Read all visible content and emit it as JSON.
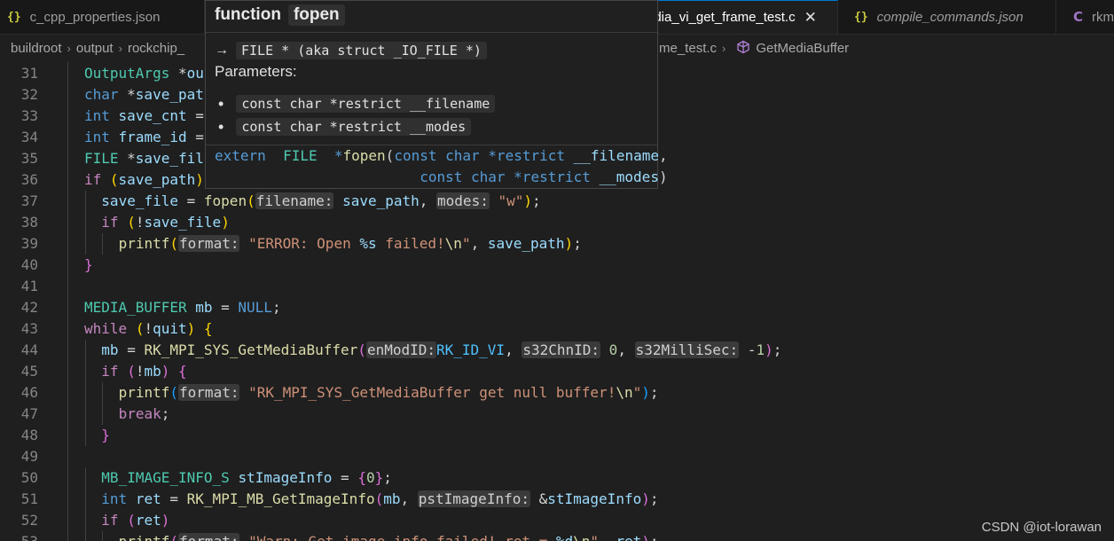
{
  "tabs": [
    {
      "icon": "{}",
      "label": "c_cpp_properties.json",
      "active": false
    },
    {
      "icon": "",
      "label": "edia_vi_get_frame_test.c",
      "active": true,
      "close": "✕"
    },
    {
      "icon": "{}",
      "label": "compile_commands.json",
      "active": false
    },
    {
      "icon": "C",
      "label": "rkm",
      "active": false
    }
  ],
  "breadcrumb": {
    "items": [
      "buildroot",
      "output",
      "rockchip_"
    ],
    "right_file": "me_test.c",
    "symbol": "GetMediaBuffer",
    "sep": "›"
  },
  "hover": {
    "kind": "function",
    "name": "fopen",
    "arrow": "→",
    "return_type": "FILE * (aka struct _IO_FILE *)",
    "params_label": "Parameters:",
    "bullet": "•",
    "params": [
      "const char *restrict __filename",
      "const char *restrict __modes"
    ],
    "signature": [
      [
        [
          "tk-kw",
          "extern"
        ],
        [
          "",
          "  "
        ],
        [
          "tk-type",
          "FILE"
        ],
        [
          "",
          "  "
        ],
        [
          "tk-kw",
          "*"
        ],
        [
          "tk-fn",
          "fopen"
        ],
        [
          "tk-op",
          "("
        ],
        [
          "tk-kw",
          "const"
        ],
        [
          "",
          " "
        ],
        [
          "tk-kw",
          "char"
        ],
        [
          "",
          " "
        ],
        [
          "tk-kw",
          "*restrict"
        ],
        [
          "",
          " "
        ],
        [
          "tk-var",
          "__filename"
        ],
        [
          "tk-op",
          ","
        ]
      ],
      [
        [
          "",
          "                        "
        ],
        [
          "tk-kw",
          "const"
        ],
        [
          "",
          " "
        ],
        [
          "tk-kw",
          "char"
        ],
        [
          "",
          " "
        ],
        [
          "tk-kw",
          "*restrict"
        ],
        [
          "",
          " "
        ],
        [
          "tk-var",
          "__modes"
        ],
        [
          "tk-op",
          ")"
        ]
      ]
    ]
  },
  "editor": {
    "lines": [
      {
        "n": "31",
        "i": 0,
        "t": [
          [
            "tk-type",
            "OutputArgs"
          ],
          [
            "tk-op",
            " *"
          ],
          [
            "tk-var",
            "ou"
          ]
        ]
      },
      {
        "n": "32",
        "i": 0,
        "t": [
          [
            "tk-kw",
            "char"
          ],
          [
            "tk-op",
            " *"
          ],
          [
            "tk-var",
            "save_pat"
          ]
        ]
      },
      {
        "n": "33",
        "i": 0,
        "t": [
          [
            "tk-kw",
            "int"
          ],
          [
            "tk-op",
            " "
          ],
          [
            "tk-var",
            "save_cnt"
          ],
          [
            "tk-op",
            " ="
          ]
        ]
      },
      {
        "n": "34",
        "i": 0,
        "t": [
          [
            "tk-kw",
            "int"
          ],
          [
            "tk-op",
            " "
          ],
          [
            "tk-var",
            "frame_id"
          ],
          [
            "tk-op",
            " ="
          ]
        ]
      },
      {
        "n": "35",
        "i": 0,
        "t": [
          [
            "tk-type",
            "FILE"
          ],
          [
            "tk-op",
            " *"
          ],
          [
            "tk-var",
            "save_fil"
          ]
        ]
      },
      {
        "n": "36",
        "i": 0,
        "t": [
          [
            "tk-ctl",
            "if"
          ],
          [
            "tk-op",
            " "
          ],
          [
            "tk-b1",
            "("
          ],
          [
            "tk-var",
            "save_path"
          ],
          [
            "tk-b1",
            ")"
          ]
        ]
      },
      {
        "n": "37",
        "i": 1,
        "t": [
          [
            "tk-var",
            "save_file"
          ],
          [
            "tk-op",
            " = "
          ],
          [
            "tk-fn",
            "fopen"
          ],
          [
            "tk-b1",
            "("
          ],
          [
            "hint",
            "filename:"
          ],
          [
            "tk-op",
            " "
          ],
          [
            "tk-var",
            "save_path"
          ],
          [
            "tk-op",
            ", "
          ],
          [
            "hint",
            "modes:"
          ],
          [
            "tk-op",
            " "
          ],
          [
            "tk-str",
            "\"w\""
          ],
          [
            "tk-b1",
            ")"
          ],
          [
            "tk-op",
            ";"
          ]
        ]
      },
      {
        "n": "38",
        "i": 1,
        "t": [
          [
            "tk-ctl",
            "if"
          ],
          [
            "tk-op",
            " "
          ],
          [
            "tk-b1",
            "("
          ],
          [
            "tk-op",
            "!"
          ],
          [
            "tk-var",
            "save_file"
          ],
          [
            "tk-b1",
            ")"
          ]
        ]
      },
      {
        "n": "39",
        "i": 2,
        "t": [
          [
            "tk-fn",
            "printf"
          ],
          [
            "tk-b1",
            "("
          ],
          [
            "hint",
            "format:"
          ],
          [
            "tk-op",
            " "
          ],
          [
            "tk-str",
            "\"ERROR: Open "
          ],
          [
            "tk-var",
            "%s"
          ],
          [
            "tk-str",
            " failed!"
          ],
          [
            "tk-fn",
            "\\n"
          ],
          [
            "tk-str",
            "\""
          ],
          [
            "tk-op",
            ", "
          ],
          [
            "tk-var",
            "save_path"
          ],
          [
            "tk-b1",
            ")"
          ],
          [
            "tk-op",
            ";"
          ]
        ]
      },
      {
        "n": "40",
        "i": 0,
        "t": [
          [
            "tk-b2",
            "}"
          ]
        ]
      },
      {
        "n": "41",
        "i": 0,
        "t": []
      },
      {
        "n": "42",
        "i": 0,
        "t": [
          [
            "tk-type",
            "MEDIA_BUFFER"
          ],
          [
            "tk-op",
            " "
          ],
          [
            "tk-var",
            "mb"
          ],
          [
            "tk-op",
            " = "
          ],
          [
            "tk-kw",
            "NULL"
          ],
          [
            "tk-op",
            ";"
          ]
        ]
      },
      {
        "n": "43",
        "i": 0,
        "t": [
          [
            "tk-ctl",
            "while"
          ],
          [
            "tk-op",
            " "
          ],
          [
            "tk-b1",
            "("
          ],
          [
            "tk-op",
            "!"
          ],
          [
            "tk-var",
            "quit"
          ],
          [
            "tk-b1",
            ")"
          ],
          [
            "tk-op",
            " "
          ],
          [
            "tk-b1",
            "{"
          ]
        ]
      },
      {
        "n": "44",
        "i": 1,
        "t": [
          [
            "tk-var",
            "mb"
          ],
          [
            "tk-op",
            " = "
          ],
          [
            "tk-fn",
            "RK_MPI_SYS_GetMediaBuffer"
          ],
          [
            "tk-b2",
            "("
          ],
          [
            "hint",
            "enModID:"
          ],
          [
            "tk-enum",
            "RK_ID_VI"
          ],
          [
            "tk-op",
            ", "
          ],
          [
            "hint",
            "s32ChnID:"
          ],
          [
            "tk-op",
            " "
          ],
          [
            "tk-num",
            "0"
          ],
          [
            "tk-op",
            ", "
          ],
          [
            "hint",
            "s32MilliSec:"
          ],
          [
            "tk-op",
            " -"
          ],
          [
            "tk-num",
            "1"
          ],
          [
            "tk-b2",
            ")"
          ],
          [
            "tk-op",
            ";"
          ]
        ]
      },
      {
        "n": "45",
        "i": 1,
        "t": [
          [
            "tk-ctl",
            "if"
          ],
          [
            "tk-op",
            " "
          ],
          [
            "tk-b2",
            "("
          ],
          [
            "tk-op",
            "!"
          ],
          [
            "tk-var",
            "mb"
          ],
          [
            "tk-b2",
            ")"
          ],
          [
            "tk-op",
            " "
          ],
          [
            "tk-b2",
            "{"
          ]
        ]
      },
      {
        "n": "46",
        "i": 2,
        "t": [
          [
            "tk-fn",
            "printf"
          ],
          [
            "tk-b3",
            "("
          ],
          [
            "hint",
            "format:"
          ],
          [
            "tk-op",
            " "
          ],
          [
            "tk-str",
            "\"RK_MPI_SYS_GetMediaBuffer get null buffer!"
          ],
          [
            "tk-fn",
            "\\n"
          ],
          [
            "tk-str",
            "\""
          ],
          [
            "tk-b3",
            ")"
          ],
          [
            "tk-op",
            ";"
          ]
        ]
      },
      {
        "n": "47",
        "i": 2,
        "t": [
          [
            "tk-ctl",
            "break"
          ],
          [
            "tk-op",
            ";"
          ]
        ]
      },
      {
        "n": "48",
        "i": 1,
        "t": [
          [
            "tk-b2",
            "}"
          ]
        ]
      },
      {
        "n": "49",
        "i": 0,
        "t": []
      },
      {
        "n": "50",
        "i": 1,
        "t": [
          [
            "tk-type",
            "MB_IMAGE_INFO_S"
          ],
          [
            "tk-op",
            " "
          ],
          [
            "tk-var",
            "stImageInfo"
          ],
          [
            "tk-op",
            " = "
          ],
          [
            "tk-b2",
            "{"
          ],
          [
            "tk-num",
            "0"
          ],
          [
            "tk-b2",
            "}"
          ],
          [
            "tk-op",
            ";"
          ]
        ]
      },
      {
        "n": "51",
        "i": 1,
        "t": [
          [
            "tk-kw",
            "int"
          ],
          [
            "tk-op",
            " "
          ],
          [
            "tk-var",
            "ret"
          ],
          [
            "tk-op",
            " = "
          ],
          [
            "tk-fn",
            "RK_MPI_MB_GetImageInfo"
          ],
          [
            "tk-b2",
            "("
          ],
          [
            "tk-var",
            "mb"
          ],
          [
            "tk-op",
            ", "
          ],
          [
            "hint",
            "pstImageInfo:"
          ],
          [
            "tk-op",
            " &"
          ],
          [
            "tk-var",
            "stImageInfo"
          ],
          [
            "tk-b2",
            ")"
          ],
          [
            "tk-op",
            ";"
          ]
        ]
      },
      {
        "n": "52",
        "i": 1,
        "t": [
          [
            "tk-ctl",
            "if"
          ],
          [
            "tk-op",
            " "
          ],
          [
            "tk-b2",
            "("
          ],
          [
            "tk-var",
            "ret"
          ],
          [
            "tk-b2",
            ")"
          ]
        ]
      },
      {
        "n": "53",
        "i": 2,
        "t": [
          [
            "tk-fn",
            "printf"
          ],
          [
            "tk-b2",
            "("
          ],
          [
            "hint",
            "format:"
          ],
          [
            "tk-op",
            " "
          ],
          [
            "tk-str",
            "\"Warn: Get image info failed! ret = "
          ],
          [
            "tk-var",
            "%d"
          ],
          [
            "tk-fn",
            "\\n"
          ],
          [
            "tk-str",
            "\""
          ],
          [
            "tk-op",
            ", "
          ],
          [
            "tk-var",
            "ret"
          ],
          [
            "tk-b2",
            ")"
          ],
          [
            "tk-op",
            ";"
          ]
        ]
      }
    ]
  },
  "watermark": "CSDN @iot-lorawan"
}
